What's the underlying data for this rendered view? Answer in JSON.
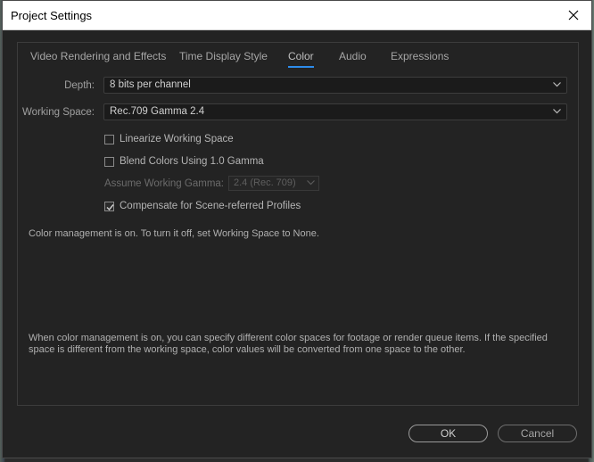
{
  "window": {
    "title": "Project Settings"
  },
  "tabs": [
    {
      "label": "Video Rendering and Effects",
      "active": false
    },
    {
      "label": "Time Display Style",
      "active": false
    },
    {
      "label": "Color",
      "active": true
    },
    {
      "label": "Audio",
      "active": false
    },
    {
      "label": "Expressions",
      "active": false
    }
  ],
  "depth": {
    "label": "Depth:",
    "value": "8 bits per channel"
  },
  "working_space": {
    "label": "Working Space:",
    "value": "Rec.709 Gamma 2.4"
  },
  "options": [
    {
      "label": "Linearize Working Space",
      "checked": false
    },
    {
      "label": "Blend Colors Using 1.0 Gamma",
      "checked": false
    }
  ],
  "gamma": {
    "label": "Assume Working Gamma:",
    "value": "2.4 (Rec. 709)",
    "enabled": false
  },
  "compensate": {
    "label": "Compensate for Scene-referred Profiles",
    "checked": true
  },
  "status_message": "Color management is on. To turn it off, set Working Space to None.",
  "info_message": "When color management is on, you can specify different color spaces for footage or render queue items. If the specified space is different from the working space, color values will be converted from one space to the other.",
  "buttons": {
    "ok": "OK",
    "cancel": "Cancel"
  },
  "colors": {
    "accent": "#2d8ceb",
    "dialog_bg": "#232323",
    "title_bg": "#ffffff"
  }
}
